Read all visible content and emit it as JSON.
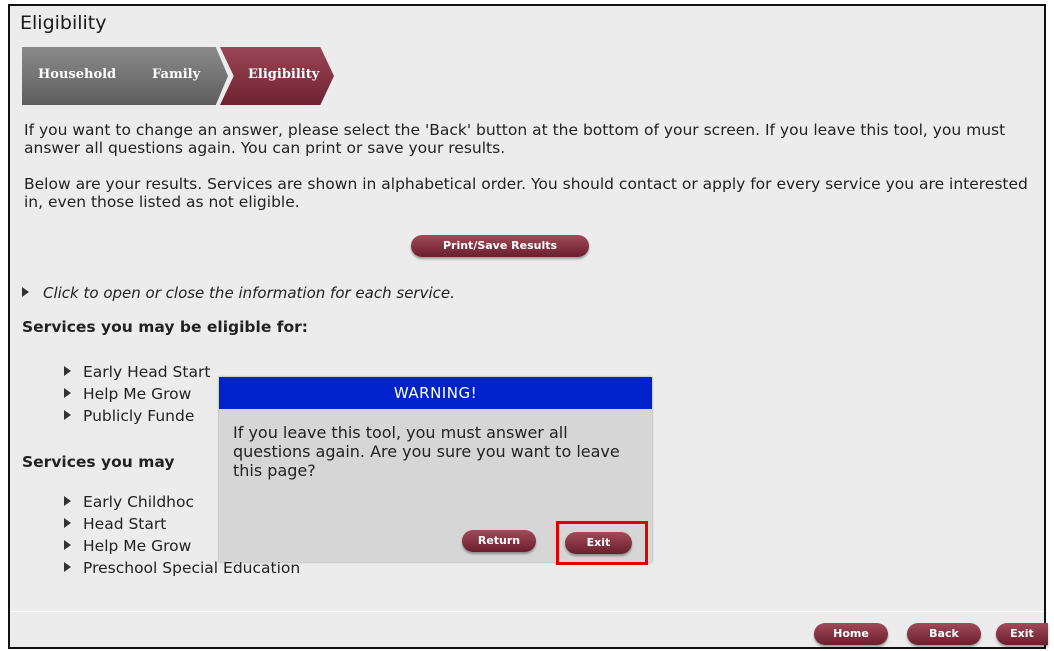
{
  "page": {
    "title": "Eligibility"
  },
  "steps": [
    {
      "label": "Household"
    },
    {
      "label": "Family"
    },
    {
      "label": "Eligibility"
    }
  ],
  "intro": {
    "paragraph1": "If you want to change an answer, please select the 'Back' button at the bottom of your screen. If you leave this tool, you must answer all questions again. You can print or save your results.",
    "paragraph2": "Below are your results. Services are shown in alphabetical order. You should contact or apply for every service you are interested in, even those listed as not eligible."
  },
  "print_button": "Print/Save Results",
  "hint": "Click to open or close the information for each service.",
  "eligible": {
    "heading": "Services you may be eligible for:",
    "items": [
      "Early Head Start",
      "Help Me Grow",
      "Publicly Funde"
    ]
  },
  "not_eligible": {
    "heading": "Services you may",
    "items": [
      "Early Childhoc",
      "Head Start",
      "Help Me Grow",
      "Preschool Special Education"
    ]
  },
  "footer": {
    "home": "Home",
    "back": "Back",
    "exit": "Exit"
  },
  "dialog": {
    "title": "WARNING!",
    "message": "If you leave this tool, you must answer all questions again. Are you sure you want to leave this page?",
    "return": "Return",
    "exit": "Exit"
  },
  "colors": {
    "accent": "#8a3344",
    "dialog_title": "#0022cc",
    "highlight": "#e00000"
  }
}
